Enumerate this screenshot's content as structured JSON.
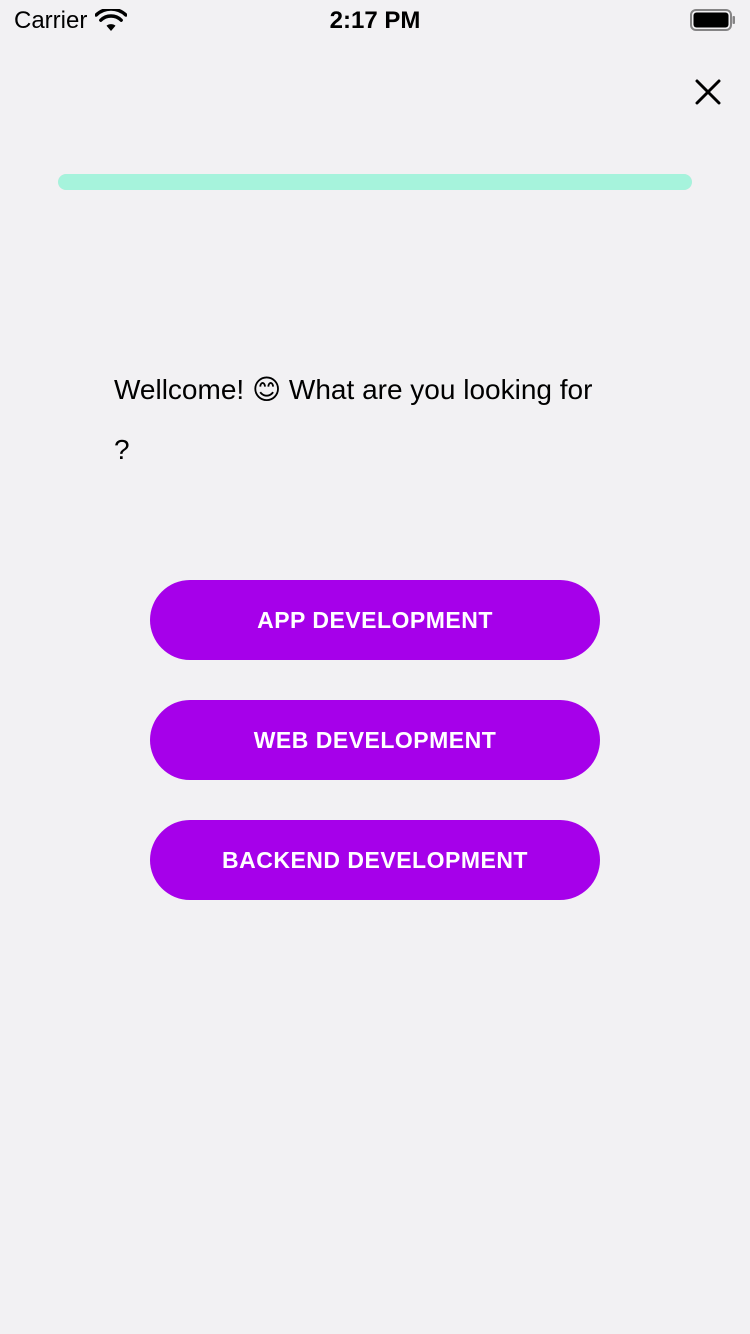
{
  "status_bar": {
    "carrier": "Carrier",
    "time": "2:17 PM"
  },
  "close": {
    "icon": "close-icon"
  },
  "progress": {
    "value": 1.0,
    "fill_color": "#a6f3dc"
  },
  "welcome": {
    "text": "Wellcome! 😊 What are you looking for ?"
  },
  "options": [
    {
      "label": "APP DEVELOPMENT"
    },
    {
      "label": "WEB DEVELOPMENT"
    },
    {
      "label": "BACKEND DEVELOPMENT"
    }
  ],
  "colors": {
    "background": "#f2f1f3",
    "button": "#a600ea",
    "button_text": "#ffffff"
  }
}
